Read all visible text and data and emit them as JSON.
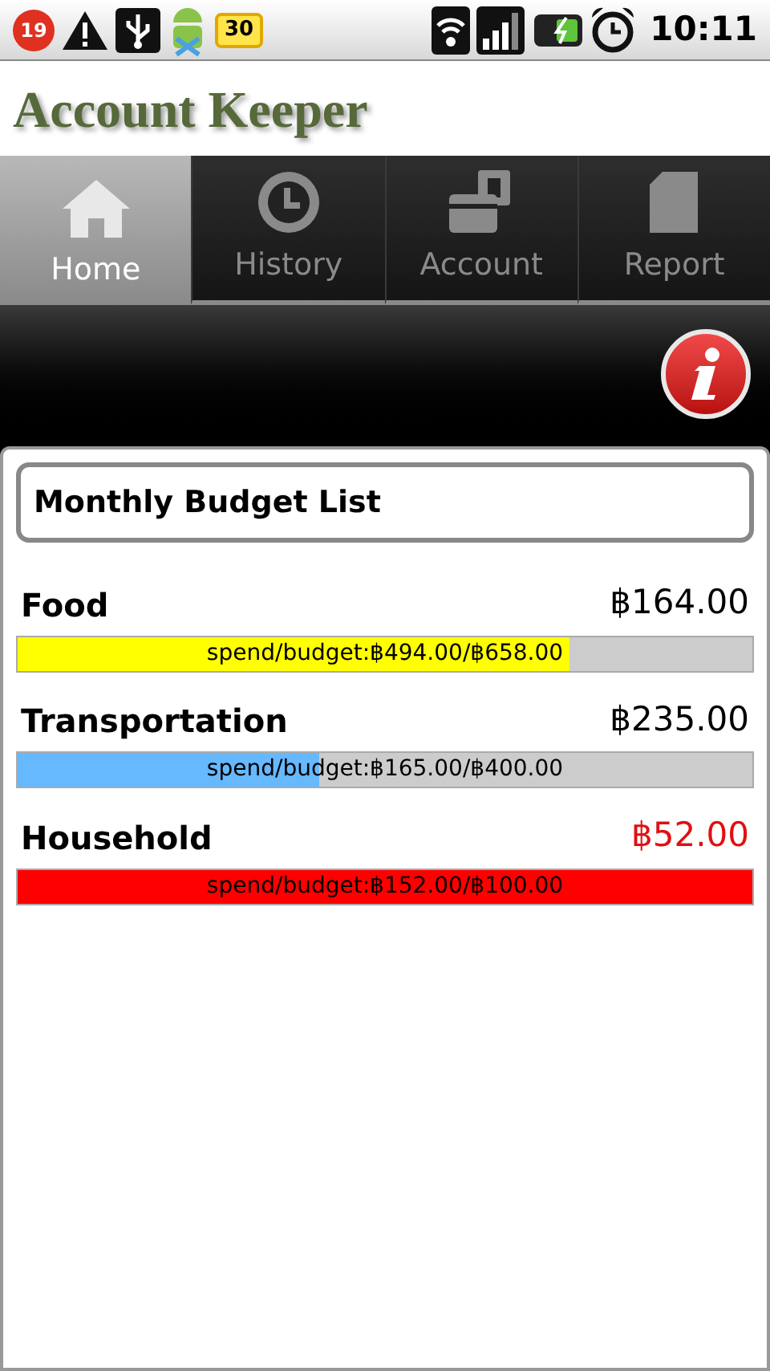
{
  "status_bar": {
    "notification_count": "19",
    "battery_badge": "30",
    "time": "10:11"
  },
  "app_title": "Account Keeper",
  "tabs": [
    {
      "label": "Home",
      "selected": true,
      "kind": "home"
    },
    {
      "label": "History",
      "selected": false,
      "kind": "history"
    },
    {
      "label": "Account",
      "selected": false,
      "kind": "account"
    },
    {
      "label": "Report",
      "selected": false,
      "kind": "report"
    }
  ],
  "budget_list": {
    "title": "Monthly Budget List",
    "items": [
      {
        "name": "Food",
        "remaining": "฿164.00",
        "over_budget": false,
        "color": "#ffff00",
        "level": 0.75,
        "summary": "spend/budget:฿494.00/฿658.00"
      },
      {
        "name": "Transportation",
        "remaining": "฿235.00",
        "over_budget": false,
        "color": "#66b8ff",
        "level": 0.41,
        "summary": "spend/budget:฿165.00/฿400.00"
      },
      {
        "name": "Household",
        "remaining": "฿52.00",
        "over_budget": true,
        "color": "#ff0000",
        "level": 1,
        "summary": "spend/budget:฿152.00/฿100.00"
      }
    ]
  }
}
